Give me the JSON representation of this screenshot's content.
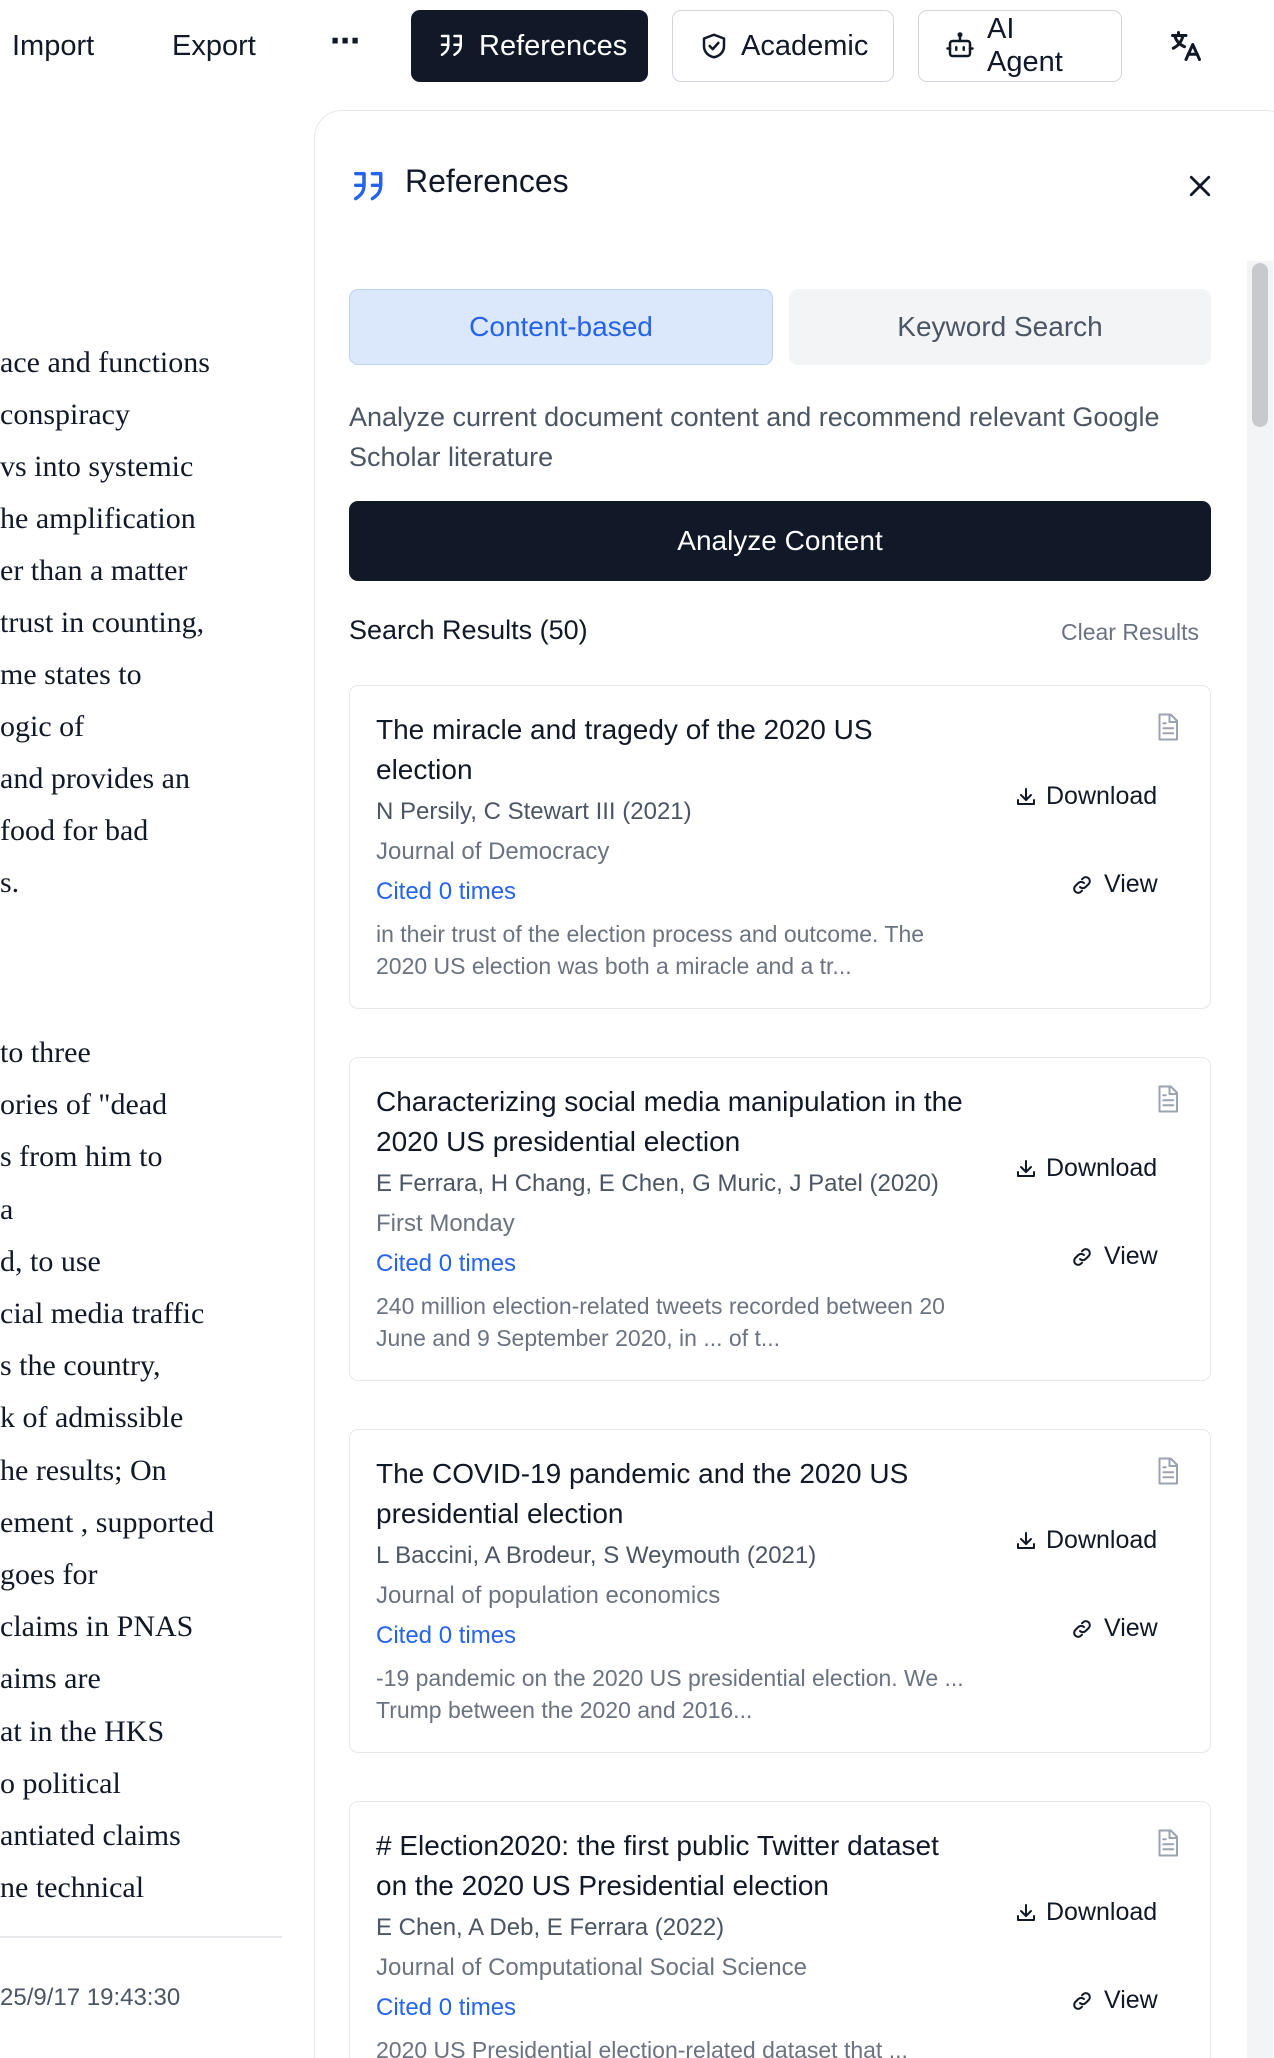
{
  "toolbar": {
    "import_label": "Import",
    "export_label": "Export",
    "more_label": "⋯",
    "references_label": "References",
    "academic_label": "Academic",
    "ai_agent_label": "AI Agent"
  },
  "document": {
    "lines_top": [
      "ace and functions",
      "conspiracy",
      "vs into systemic",
      "he amplification",
      "er than a matter",
      "trust in counting,",
      "me states to",
      "ogic of",
      "and provides an",
      "food for bad",
      "s."
    ],
    "lines_bottom": [
      "to three",
      "ories of \"dead",
      "s from him to",
      " a",
      "d, to use",
      "cial media traffic",
      "s the country,",
      "k of admissible",
      "he results; On",
      "ement , supported",
      "goes for",
      "claims in PNAS",
      "aims are",
      "at in the HKS",
      "o political",
      "antiated claims",
      "ne technical"
    ],
    "timestamp": "25/9/17 19:43:30"
  },
  "panel": {
    "title": "References",
    "tabs": [
      {
        "label": "Content-based",
        "active": true
      },
      {
        "label": "Keyword Search",
        "active": false
      }
    ],
    "description": "Analyze current document content and recommend relevant Google Scholar literature",
    "analyze_label": "Analyze Content",
    "results_heading": "Search Results (50)",
    "clear_label": "Clear Results",
    "download_label": "Download",
    "view_label": "View",
    "results": [
      {
        "title": "The miracle and tragedy of the 2020 US election",
        "authors": "N Persily, C Stewart III (2021)",
        "journal": "Journal of Democracy",
        "cited": "Cited 0 times",
        "snippet": "in their trust of the election process and outcome. The 2020 US election was both a miracle and a tr..."
      },
      {
        "title": "Characterizing social media manipulation in the 2020 US presidential election",
        "authors": "E Ferrara, H Chang, E Chen, G Muric, J Patel (2020)",
        "journal": "First Monday",
        "cited": "Cited 0 times",
        "snippet": "240 million election-related tweets recorded between 20 June and 9 September 2020, in ... of t..."
      },
      {
        "title": "The COVID-19 pandemic and the 2020 US presidential election",
        "authors": "L Baccini, A Brodeur, S Weymouth (2021)",
        "journal": "Journal of population economics",
        "cited": "Cited 0 times",
        "snippet": "-19 pandemic on the 2020 US presidential election. We ... Trump between the 2020 and 2016..."
      },
      {
        "title": "# Election2020: the first public Twitter dataset on the 2020 US Presidential election",
        "authors": "E Chen, A Deb, E Ferrara (2022)",
        "journal": "Journal of Computational Social Science",
        "cited": "Cited 0 times",
        "snippet": "2020 US Presidential election-related dataset that ..."
      }
    ]
  },
  "colors": {
    "primary_dark": "#111827",
    "accent_blue": "#2563eb",
    "active_tab_bg": "#dbe7fb"
  }
}
